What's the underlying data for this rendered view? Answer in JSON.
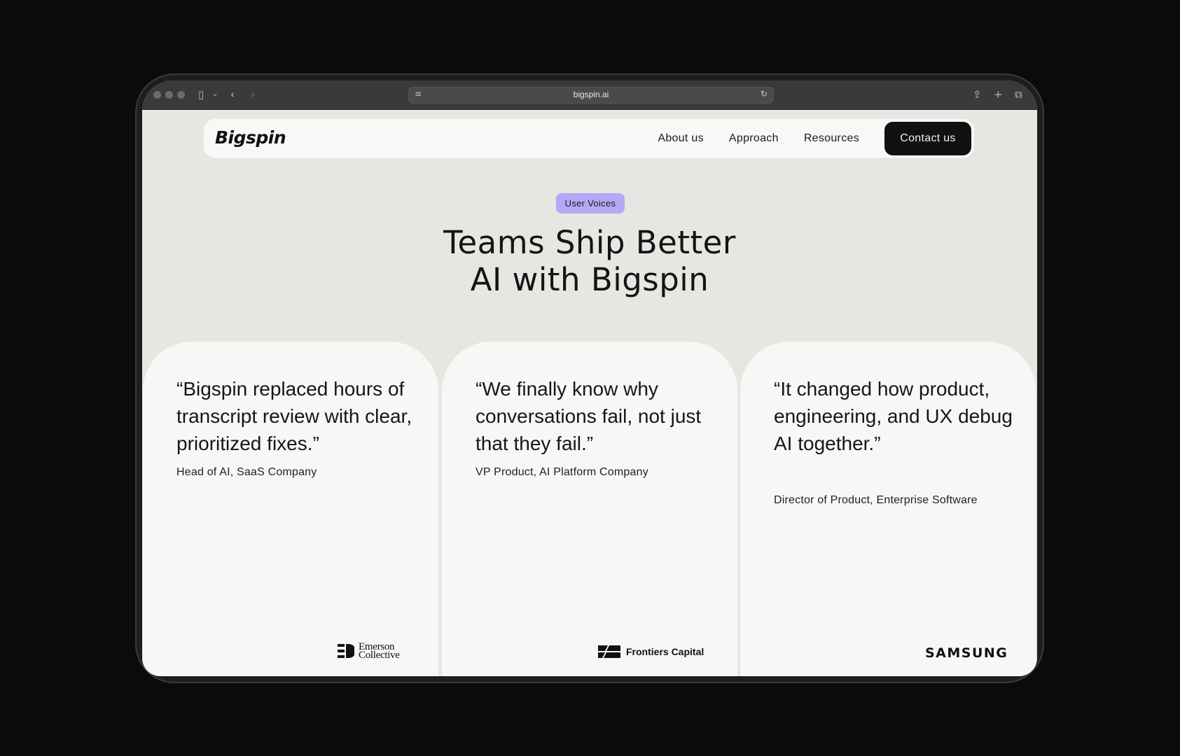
{
  "browser": {
    "url": "bigspin.ai",
    "icons": [
      "close-dot",
      "minimize-dot",
      "zoom-dot",
      "sidebar-icon",
      "chevron-down-icon",
      "back-icon",
      "forward-icon",
      "page-menu-icon",
      "translate-icon",
      "reload-icon",
      "share-icon",
      "new-tab-icon",
      "tabs-overview-icon"
    ]
  },
  "nav": {
    "logo": "Bigspin",
    "links": [
      "About us",
      "Approach",
      "Resources"
    ],
    "cta": "Contact us"
  },
  "hero": {
    "badge": "User Voices",
    "title_line1": "Teams Ship Better",
    "title_line2": "AI with Bigspin"
  },
  "testimonials": [
    {
      "quote": "“Bigspin replaced hours of transcript review with clear, prioritized fixes.”",
      "author": "Head of AI, SaaS Company",
      "logo": "Emerson Collective",
      "logo_line1": "Emerson",
      "logo_line2": "Collective"
    },
    {
      "quote": "“We finally know why conversations fail, not just that they fail.”",
      "author": "VP Product, AI Platform Company",
      "logo": "Frontiers Capital"
    },
    {
      "quote": "“It changed how product, engineering, and UX debug AI together.”",
      "author": "Director of Product, Enterprise Software",
      "logo": "SAMSUNG"
    }
  ],
  "colors": {
    "page_bg": "#e7e6e2",
    "card_bg": "#f7f7f5",
    "badge": "#b5a8f5",
    "cta_bg": "#111111"
  }
}
